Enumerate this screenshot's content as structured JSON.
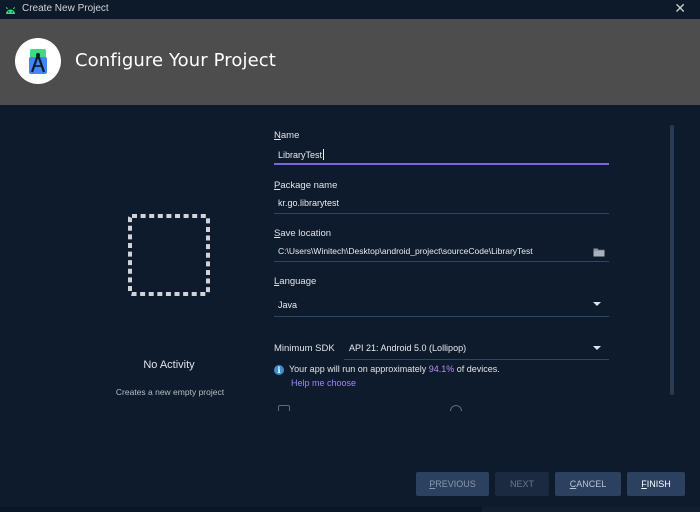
{
  "window": {
    "title": "Create New Project",
    "close_glyph": "✕",
    "app_icon": "android-studio-icon"
  },
  "header": {
    "title": "Configure Your Project",
    "logo_icon": "android-studio-logo-icon"
  },
  "template": {
    "name": "No Activity",
    "description": "Creates a new empty project"
  },
  "form": {
    "name": {
      "label_u": "N",
      "label_rest": "ame",
      "value": "LibraryTest"
    },
    "package": {
      "label_u": "P",
      "label_rest": "ackage name",
      "value": "kr.go.librarytest"
    },
    "save_location": {
      "label_u": "S",
      "label_rest": "ave location",
      "value": "C:\\Users\\Winitech\\Desktop\\android_project\\sourceCode\\LibraryTest"
    },
    "language": {
      "label_u": "L",
      "label_rest": "anguage",
      "value": "Java"
    },
    "min_sdk": {
      "label": "Minimum SDK",
      "value": "API 21: Android 5.0 (Lollipop)"
    }
  },
  "info": {
    "text_before": "Your app will run on approximately ",
    "percent": "94.1%",
    "text_after": " of devices.",
    "help_link": "Help me choose"
  },
  "buttons": {
    "previous": {
      "u": "P",
      "rest": "REVIOUS"
    },
    "next": {
      "label": "NEXT"
    },
    "cancel": {
      "u": "C",
      "rest": "ANCEL"
    },
    "finish": {
      "u": "F",
      "rest": "INISH"
    }
  },
  "colors": {
    "accent": "#7b68d8",
    "link": "#9f88f0",
    "percent": "#b690f0",
    "background": "#0e1b2c",
    "header": "#4d4d4d"
  }
}
